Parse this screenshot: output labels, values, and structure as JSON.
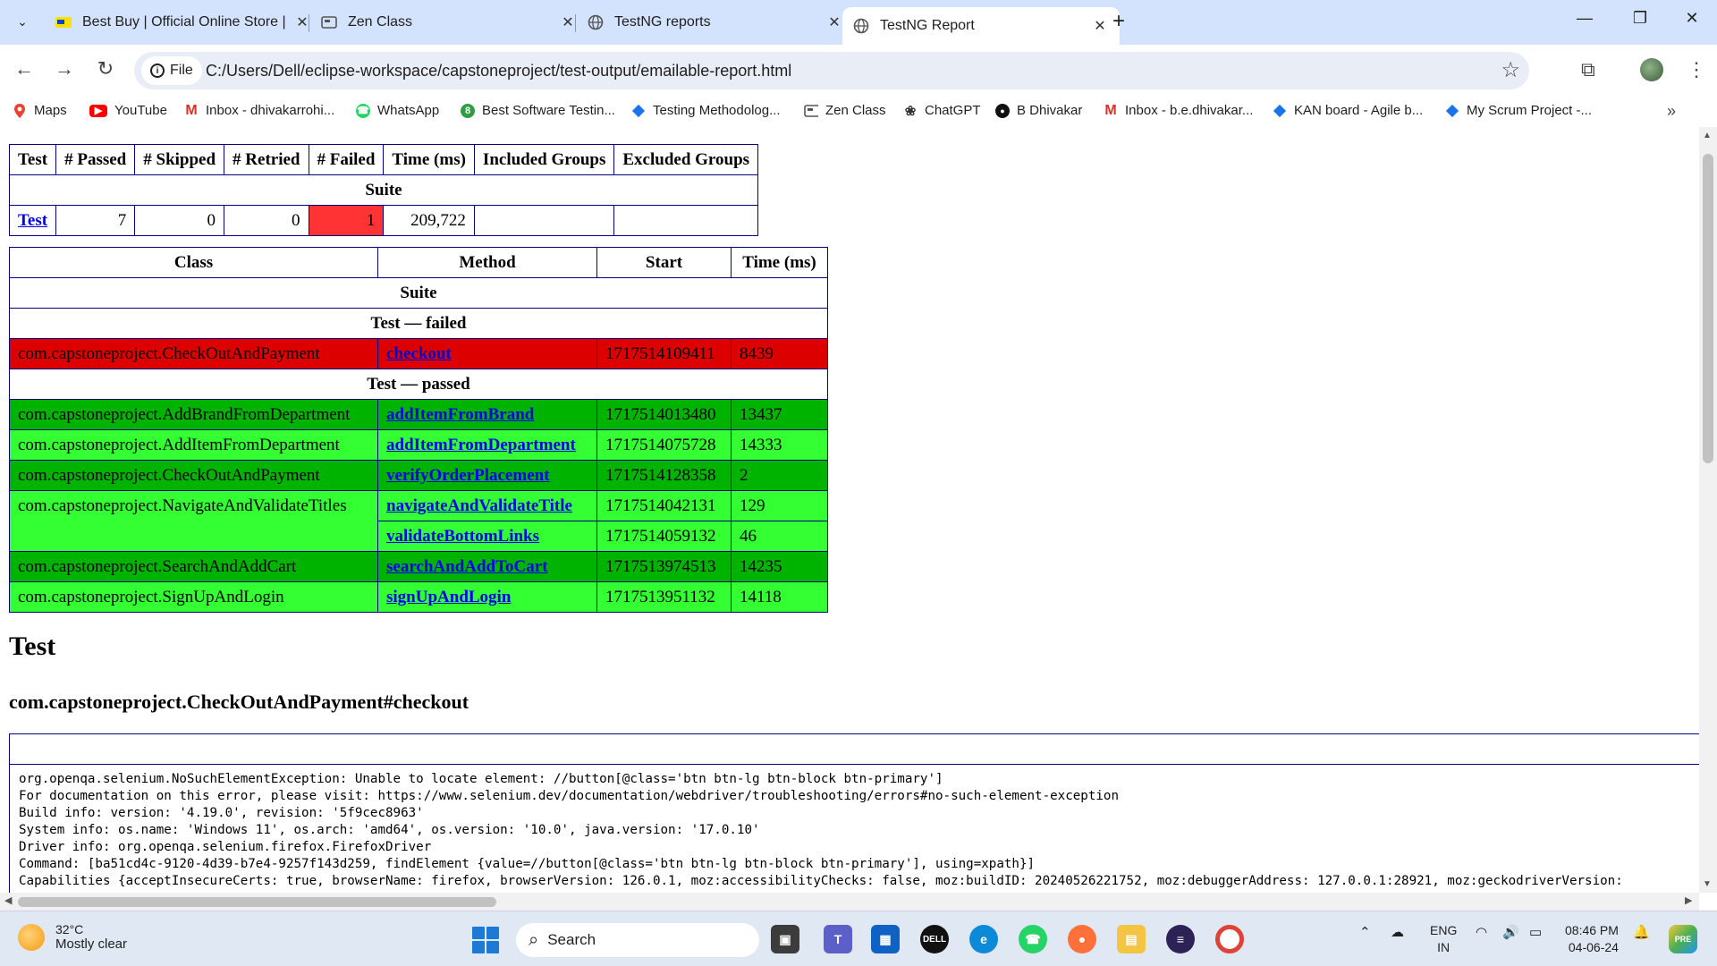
{
  "browser": {
    "tabs": [
      {
        "title": "Best Buy | Official Online Store |",
        "icon": "bestbuy-icon",
        "active": false
      },
      {
        "title": "Zen Class",
        "icon": "zenclass-icon",
        "active": false
      },
      {
        "title": "TestNG reports",
        "icon": "globe-icon",
        "active": false
      },
      {
        "title": "TestNG Report",
        "icon": "globe-icon",
        "active": true
      }
    ],
    "url_chip": "File",
    "url": "C:/Users/Dell/eclipse-workspace/capstoneproject/test-output/emailable-report.html",
    "bookmarks": [
      {
        "label": "Maps",
        "icon": "maps-icon",
        "color": "#ea4335"
      },
      {
        "label": "YouTube",
        "icon": "youtube-icon",
        "color": "#ff0000"
      },
      {
        "label": "Inbox - dhivakarrohi...",
        "icon": "gmail-icon",
        "color": "#d93025"
      },
      {
        "label": "WhatsApp",
        "icon": "whatsapp-icon",
        "color": "#25d366"
      },
      {
        "label": "Best Software Testin...",
        "icon": "bst-icon",
        "color": "#2e9e44"
      },
      {
        "label": "Testing Methodolog...",
        "icon": "diamond-icon",
        "color": "#1a73e8"
      },
      {
        "label": "Zen Class",
        "icon": "zenclass-icon",
        "color": "#555555"
      },
      {
        "label": "ChatGPT",
        "icon": "chatgpt-icon",
        "color": "#333333"
      },
      {
        "label": "B Dhivakar",
        "icon": "github-icon",
        "color": "#111111"
      },
      {
        "label": "Inbox - b.e.dhivakar...",
        "icon": "gmail-icon",
        "color": "#d93025"
      },
      {
        "label": "KAN board - Agile b...",
        "icon": "jira-icon",
        "color": "#1a73e8"
      },
      {
        "label": "My Scrum Project -...",
        "icon": "jira-icon",
        "color": "#1a73e8"
      }
    ]
  },
  "summary_table": {
    "headers": [
      "Test",
      "# Passed",
      "# Skipped",
      "# Retried",
      "# Failed",
      "Time (ms)",
      "Included Groups",
      "Excluded Groups"
    ],
    "suite_label": "Suite",
    "row": {
      "test": "Test",
      "passed": "7",
      "skipped": "0",
      "retried": "0",
      "failed": "1",
      "time": "209,722",
      "included": "",
      "excluded": ""
    }
  },
  "methods_table": {
    "headers": [
      "Class",
      "Method",
      "Start",
      "Time (ms)"
    ],
    "suite_label": "Suite",
    "failed_label": "Test — failed",
    "passed_label": "Test — passed",
    "failed_rows": [
      {
        "class": "com.capstoneproject.CheckOutAndPayment",
        "method": "checkout",
        "start": "1717514109411",
        "time": "8439"
      }
    ],
    "passed_rows": [
      {
        "class": "com.capstoneproject.AddBrandFromDepartment",
        "method": "addItemFromBrand",
        "start": "1717514013480",
        "time": "13437"
      },
      {
        "class": "com.capstoneproject.AddItemFromDepartment",
        "method": "addItemFromDepartment",
        "start": "1717514075728",
        "time": "14333"
      },
      {
        "class": "com.capstoneproject.CheckOutAndPayment",
        "method": "verifyOrderPlacement",
        "start": "1717514128358",
        "time": "2"
      },
      {
        "class": "com.capstoneproject.NavigateAndValidateTitles",
        "method": "navigateAndValidateTitle",
        "start": "1717514042131",
        "time": "129"
      },
      {
        "class": "",
        "method": "validateBottomLinks",
        "start": "1717514059132",
        "time": "46"
      },
      {
        "class": "com.capstoneproject.SearchAndAddCart",
        "method": "searchAndAddToCart",
        "start": "1717513974513",
        "time": "14235"
      },
      {
        "class": "com.capstoneproject.SignUpAndLogin",
        "method": "signUpAndLogin",
        "start": "1717513951132",
        "time": "14118"
      }
    ]
  },
  "detail": {
    "test_heading": "Test",
    "method_heading": "com.capstoneproject.CheckOutAndPayment#checkout",
    "error_lines": [
      "org.openqa.selenium.NoSuchElementException: Unable to locate element: //button[@class='btn btn-lg btn-block btn-primary']",
      "For documentation on this error, please visit: https://www.selenium.dev/documentation/webdriver/troubleshooting/errors#no-such-element-exception",
      "Build info: version: '4.19.0', revision: '5f9cec8963'",
      "System info: os.name: 'Windows 11', os.arch: 'amd64', os.version: '10.0', java.version: '17.0.10'",
      "Driver info: org.openqa.selenium.firefox.FirefoxDriver",
      "Command: [ba51cd4c-9120-4d39-b7e4-9257f143d259, findElement {value=//button[@class='btn btn-lg btn-block btn-primary'], using=xpath}]",
      "Capabilities {acceptInsecureCerts: true, browserName: firefox, browserVersion: 126.0.1, moz:accessibilityChecks: false, moz:buildID: 20240526221752, moz:debuggerAddress: 127.0.0.1:28921, moz:geckodriverVersion:"
    ]
  },
  "colors": {
    "failed_row": "#dd0000",
    "failed_cell": "#ff3333",
    "passed_dark": "#00b300",
    "passed_light": "#33ff33",
    "table_border": "#000080"
  },
  "taskbar": {
    "weather_temp": "32°C",
    "weather_desc": "Mostly clear",
    "search_label": "Search",
    "lang_top": "ENG",
    "lang_bottom": "IN",
    "time": "08:46 PM",
    "date": "04-06-24"
  }
}
